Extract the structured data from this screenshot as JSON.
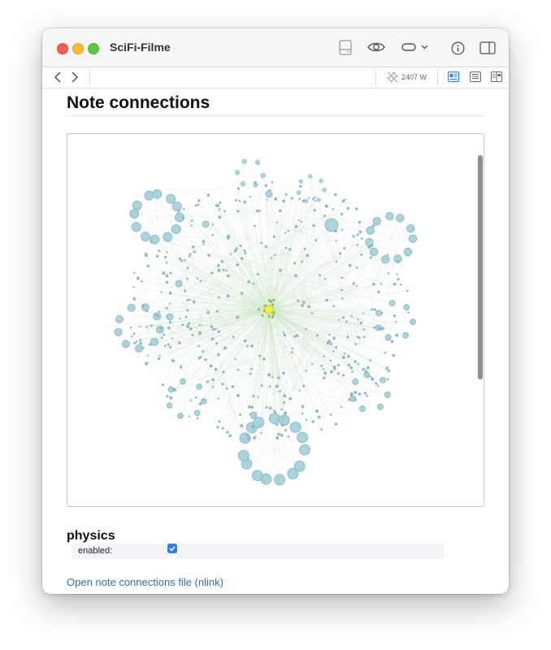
{
  "window": {
    "title": "SciFi-Filme"
  },
  "toolbar": {
    "icons": [
      "layout-split-icon",
      "eye-icon",
      "toggle-dropdown-icon",
      "info-icon",
      "sidebar-icon"
    ]
  },
  "navbar": {
    "word_count": "2407 W",
    "icons": [
      "back-arrow-icon",
      "forward-arrow-icon",
      "disabled-pin-icon",
      "reading-view-icon",
      "editor-view-icon",
      "split-view-icon"
    ]
  },
  "content": {
    "heading": "Note connections",
    "physics_title": "physics",
    "physics_enabled_label": "enabled:",
    "physics_enabled": true,
    "link_text": "Open note connections file (nlink)"
  },
  "colors": {
    "node_fill": "#a9d3dd",
    "node_stroke": "#87b3c0",
    "edge": "#cde9c6",
    "center_node": "#f4ef3c",
    "link": "#2f6fb6",
    "checkbox": "#2d7ff0"
  }
}
